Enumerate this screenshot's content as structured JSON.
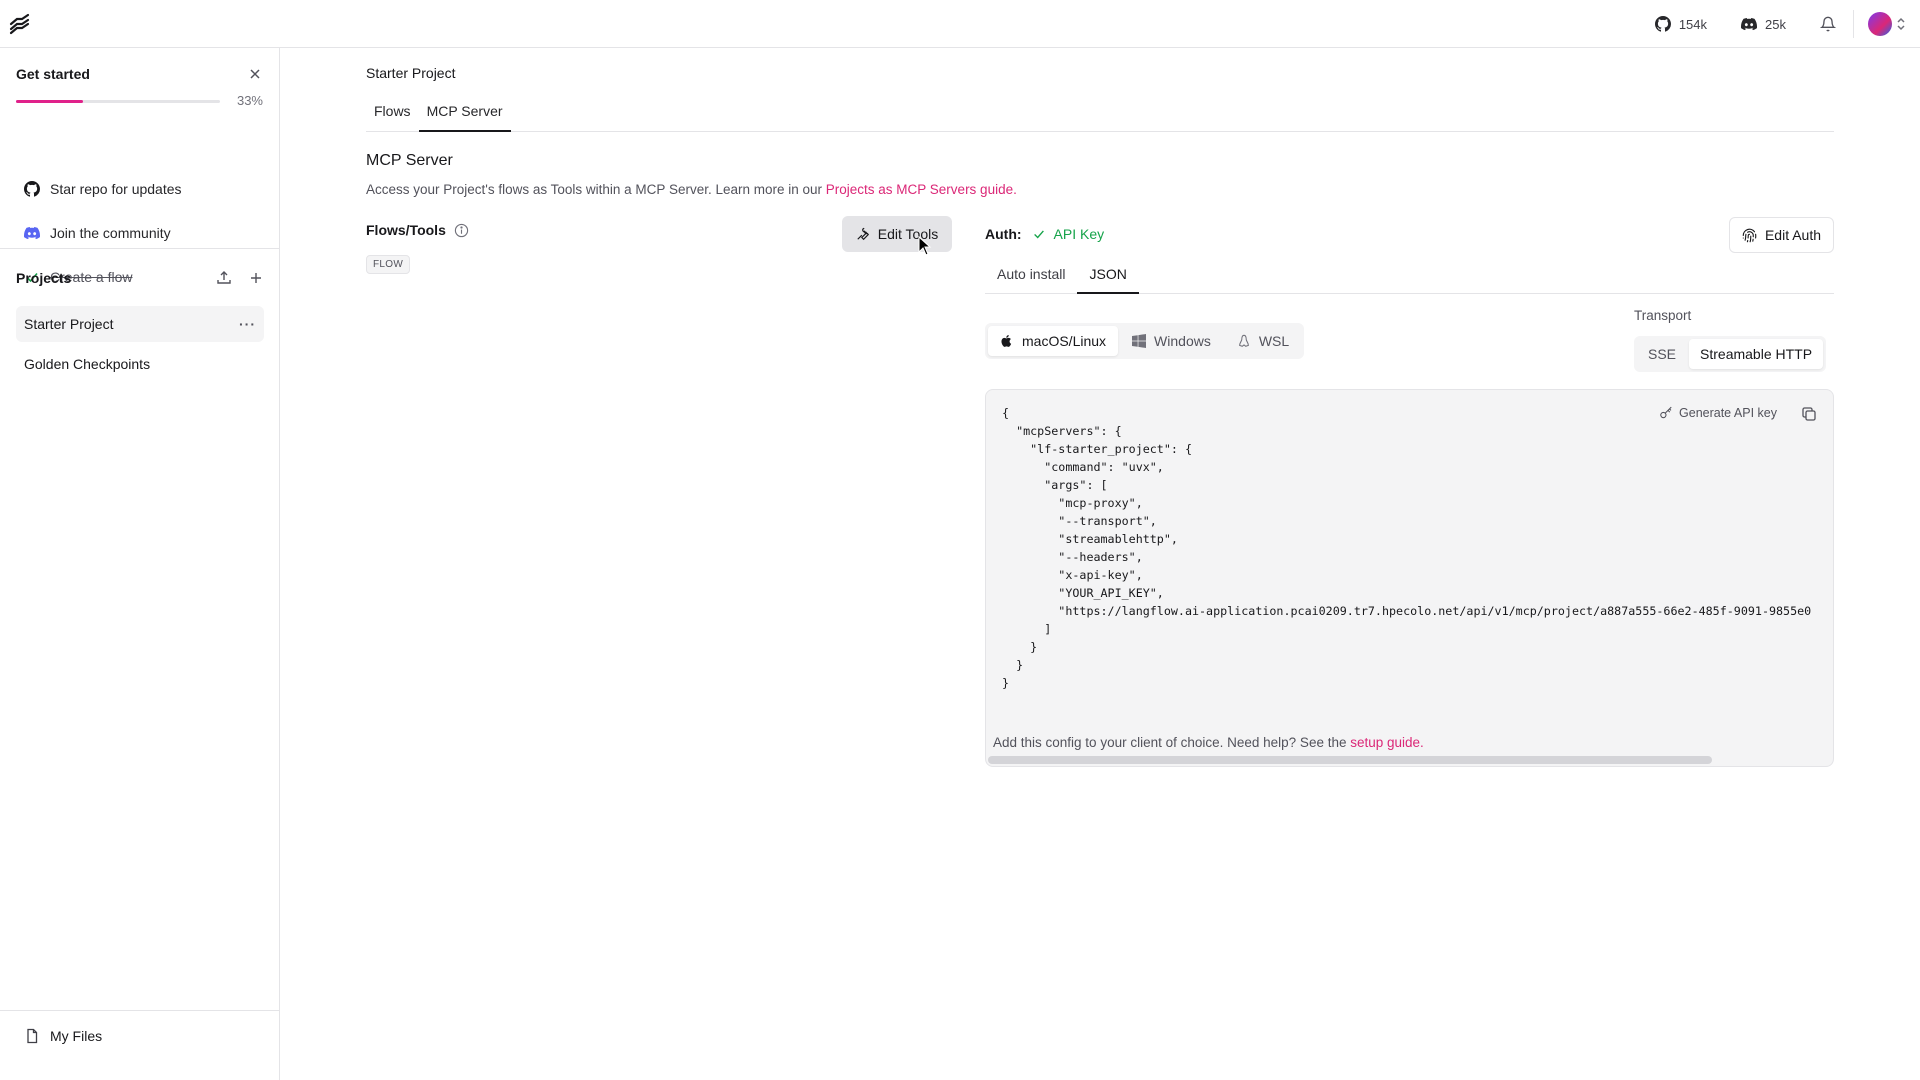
{
  "topbar": {
    "github_count": "154k",
    "discord_count": "25k"
  },
  "sidebar": {
    "get_started": {
      "title": "Get started",
      "progress_percent": 33,
      "progress_label": "33%",
      "items": [
        {
          "label": "Star repo for updates",
          "icon": "github-icon",
          "done": false
        },
        {
          "label": "Join the community",
          "icon": "discord-icon",
          "done": false
        },
        {
          "label": "Create a flow",
          "icon": "check-icon",
          "done": true
        }
      ]
    },
    "projects": {
      "title": "Projects",
      "items": [
        {
          "label": "Starter Project",
          "active": true
        },
        {
          "label": "Golden Checkpoints",
          "active": false
        }
      ]
    },
    "my_files": "My Files"
  },
  "main": {
    "breadcrumb": "Starter Project",
    "tabs": [
      {
        "label": "Flows",
        "active": false
      },
      {
        "label": "MCP Server",
        "active": true
      }
    ],
    "section_title": "MCP Server",
    "description_prefix": "Access your Project's flows as Tools within a MCP Server. Learn more in our ",
    "description_link": "Projects as MCP Servers guide.",
    "flows_tools_title": "Flows/Tools",
    "flow_badge": "FLOW",
    "edit_tools_label": "Edit Tools",
    "auth_label": "Auth:",
    "auth_value": "API Key",
    "edit_auth_label": "Edit Auth",
    "subtabs": [
      {
        "label": "Auto install",
        "active": false
      },
      {
        "label": "JSON",
        "active": true
      }
    ],
    "os_options": [
      {
        "label": "macOS/Linux",
        "icon": "apple-icon",
        "active": true
      },
      {
        "label": "Windows",
        "icon": "windows-icon",
        "active": false
      },
      {
        "label": "WSL",
        "icon": "linux-icon",
        "active": false
      }
    ],
    "transport_label": "Transport",
    "transport_options": [
      {
        "label": "SSE",
        "active": false
      },
      {
        "label": "Streamable HTTP",
        "active": true
      }
    ],
    "generate_api_key": "Generate API key",
    "code_lines": [
      "{",
      "  \"mcpServers\": {",
      "    \"lf-starter_project\": {",
      "      \"command\": \"uvx\",",
      "      \"args\": [",
      "        \"mcp-proxy\",",
      "        \"--transport\",",
      "        \"streamablehttp\",",
      "        \"--headers\",",
      "        \"x-api-key\",",
      "        \"YOUR_API_KEY\",",
      "        \"https://langflow.ai-application.pcai0209.tr7.hpecolo.net/api/v1/mcp/project/a887a555-66e2-485f-9091-9855e0",
      "      ]",
      "    }",
      "  }",
      "}"
    ],
    "help_prefix": "Add this config to your client of choice. Need help? See the ",
    "help_link": "setup guide."
  },
  "colors": {
    "accent": "#db2777",
    "success": "#16a34a"
  }
}
